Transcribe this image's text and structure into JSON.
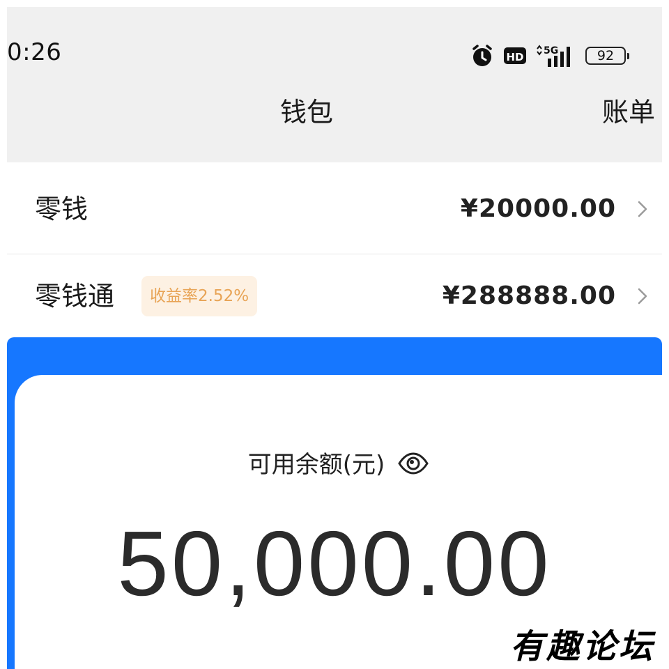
{
  "status_bar": {
    "time": "0:26",
    "icons": [
      "alarm-icon",
      "hd-icon",
      "5g-signal-icon",
      "battery-icon"
    ],
    "network_label": "5G",
    "hd_label": "HD",
    "battery_level": "92"
  },
  "nav": {
    "title": "钱包",
    "bill_link": "账单"
  },
  "wallet_rows": [
    {
      "label": "零钱",
      "amount": "¥20000.00",
      "badge": ""
    },
    {
      "label": "零钱通",
      "amount": "¥288888.00",
      "badge": "收益率2.52%"
    }
  ],
  "balance_card": {
    "label": "可用余额(元)",
    "amount": "50,000.00",
    "toggle_icon": "eye-icon"
  },
  "watermark": "有趣论坛",
  "colors": {
    "header_bg": "#f0f0f0",
    "accent_blue": "#1677ff",
    "badge_bg": "#fdf1e3",
    "badge_text": "#e8a456"
  }
}
